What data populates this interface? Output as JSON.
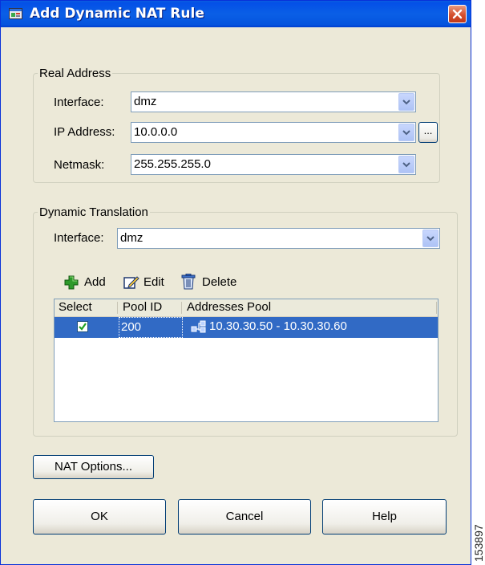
{
  "dialog": {
    "title": "Add Dynamic NAT Rule"
  },
  "real_address": {
    "legend": "Real Address",
    "interface_label": "Interface:",
    "interface_value": "dmz",
    "ip_label": "IP Address:",
    "ip_value": "10.0.0.0",
    "browse_label": "...",
    "netmask_label": "Netmask:",
    "netmask_value": "255.255.255.0"
  },
  "dynamic_translation": {
    "legend": "Dynamic Translation",
    "interface_label": "Interface:",
    "interface_value": "dmz",
    "toolbar": {
      "add": "Add",
      "edit": "Edit",
      "delete": "Delete"
    },
    "table": {
      "columns": [
        "Select",
        "Pool ID",
        "Addresses Pool"
      ],
      "rows": [
        {
          "selected": true,
          "pool_id": "200",
          "addresses_pool": "10.30.30.50 - 10.30.30.60"
        }
      ]
    }
  },
  "buttons": {
    "nat_options": "NAT Options...",
    "ok": "OK",
    "cancel": "Cancel",
    "help": "Help"
  },
  "watermark": "153897",
  "icons": {
    "title": "dialog-app-icon",
    "close": "close-icon",
    "add": "green-plus-icon",
    "edit": "edit-pencil-icon",
    "delete": "trash-can-icon",
    "pool": "network-pool-icon"
  },
  "colors": {
    "titlebar": "#0554de",
    "close_button": "#d4502e",
    "selection": "#316ac5",
    "dialog_bg": "#ece9d8"
  }
}
